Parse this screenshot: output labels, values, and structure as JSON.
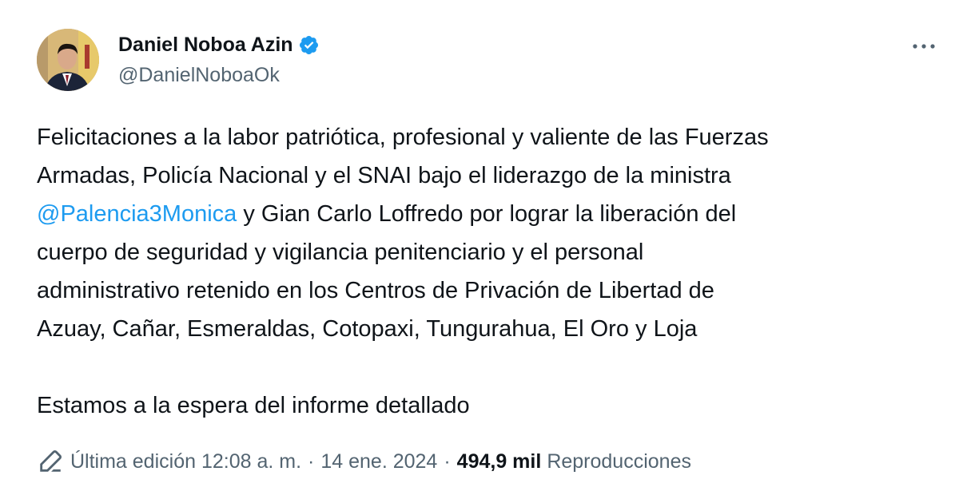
{
  "author": {
    "display_name": "Daniel Noboa Azin",
    "handle": "@DanielNoboaOk",
    "verified": true
  },
  "tweet": {
    "lines": [
      "Felicitaciones a la labor patriótica, profesional y valiente de las Fuerzas",
      "Armadas, Policía Nacional y el SNAI bajo el liderazgo de la ministra"
    ],
    "mention": "@Palencia3Monica",
    "mention_rest": " y Gian Carlo Loffredo por lograr la liberación del",
    "lines_after": [
      "cuerpo de seguridad y vigilancia penitenciario y el personal",
      "administrativo retenido en los Centros de Privación de Libertad de",
      "Azuay, Cañar, Esmeraldas, Cotopaxi, Tungurahua, El Oro y Loja"
    ],
    "paragraph2": "Estamos a la espera del informe detallado"
  },
  "meta": {
    "edit_label": "Última edición 12:08 a. m.",
    "separator": "·",
    "date": "14 ene. 2024",
    "views_count": "494,9 mil",
    "views_label": "Reproducciones"
  },
  "colors": {
    "accent": "#1d9bf0",
    "text": "#0f1419",
    "secondary": "#536471"
  },
  "icons": {
    "verified": "verified-badge-icon",
    "more": "more-options-icon",
    "edit": "pencil-icon"
  }
}
